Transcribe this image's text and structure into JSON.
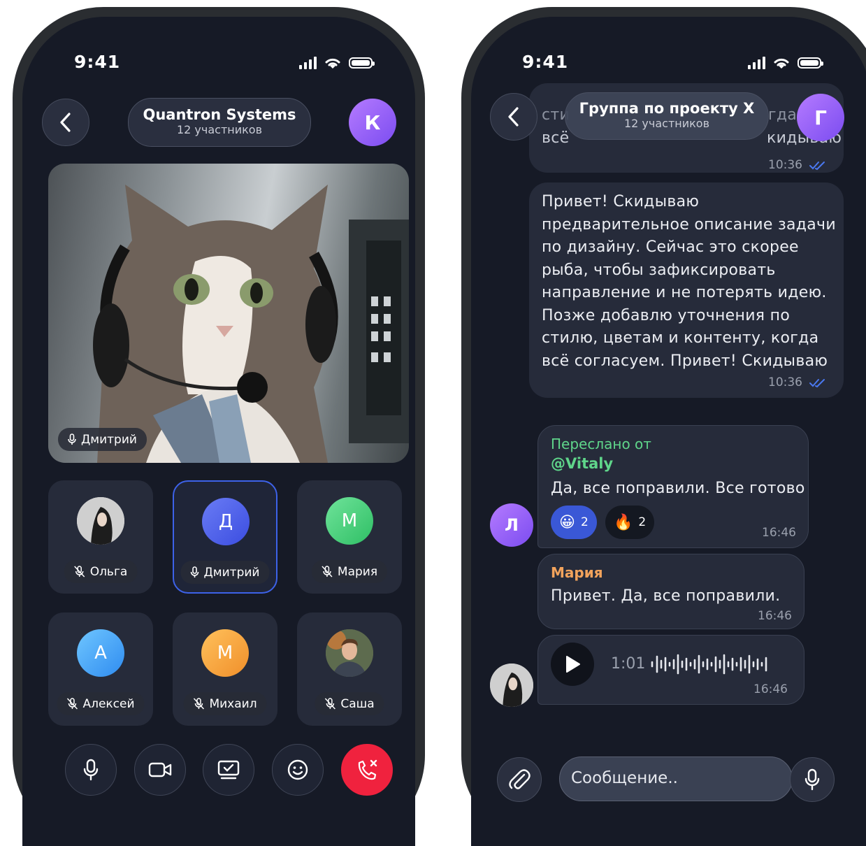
{
  "call_screen": {
    "status_time": "9:41",
    "title": "Quantron Systems",
    "subtitle": "12 участников",
    "avatar_letter": "К",
    "speaker_name": "Дмитрий",
    "participants": [
      {
        "name": "Ольга",
        "letter": "",
        "muted": true
      },
      {
        "name": "Дмитрий",
        "letter": "Д",
        "muted": false,
        "active": true
      },
      {
        "name": "Мария",
        "letter": "М",
        "muted": true
      },
      {
        "name": "Алексей",
        "letter": "А",
        "muted": true
      },
      {
        "name": "Михаил",
        "letter": "М",
        "muted": true
      },
      {
        "name": "Саша",
        "letter": "",
        "muted": true
      }
    ],
    "controls": [
      "microphone-icon",
      "camera-icon",
      "screen-share-icon",
      "emoji-icon",
      "end-call-icon"
    ]
  },
  "chat_screen": {
    "status_time": "9:41",
    "title": "Группа по проекту X",
    "subtitle": "12 участников",
    "avatar_letter": "Г",
    "prev_msg_fragment_1": "сти",
    "prev_msg_fragment_2": "всё",
    "prev_msg_fragment_3": "гда",
    "prev_msg_fragment_4": "кидываю",
    "prev_msg_time": "10:36",
    "message_main": {
      "lines": [
        "Привет! Скидываю",
        "предварительное описание задачи",
        "по дизайну. Сейчас это скорее",
        "рыба, чтобы зафиксировать",
        "направление и не потерять идею.",
        "Позже добавлю уточнения по",
        "стилю, цветам и контенту, когда",
        "всё согласуем. Привет! Скидываю"
      ],
      "time": "10:36"
    },
    "forwarded": {
      "label": "Переслано от",
      "from": "@Vitaly",
      "text": "Да, все поправили. Все готово",
      "reactions": [
        {
          "emoji": "😀",
          "count": "2"
        },
        {
          "emoji": "🔥",
          "count": "2"
        }
      ],
      "time": "16:46",
      "sender_letter": "Л"
    },
    "maria_msg": {
      "author": "Мария",
      "text": "Привет. Да, все поправили.",
      "time": "16:46"
    },
    "voice_msg": {
      "duration": "1:01",
      "time": "16:46"
    },
    "composer": {
      "placeholder": "Сообщение.."
    }
  }
}
